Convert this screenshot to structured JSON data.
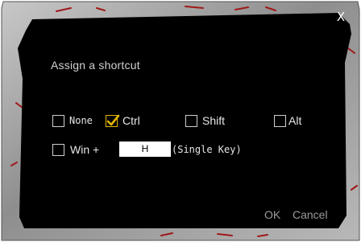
{
  "dialog": {
    "title": "Assign a shortcut",
    "close_label": "X"
  },
  "modifiers": [
    {
      "label": "None",
      "checked": false
    },
    {
      "label": "Ctrl",
      "checked": true
    },
    {
      "label": "Shift",
      "checked": false
    },
    {
      "label": "Alt",
      "checked": false
    }
  ],
  "win": {
    "label": "Win +",
    "checked": false,
    "key_value": "H",
    "hint": "(Single Key)"
  },
  "buttons": {
    "ok": "OK",
    "cancel": "Cancel"
  },
  "colors": {
    "panel": "#000000",
    "frame": "#9a9a9a",
    "accent_check": "#e3b300",
    "text": "#e6e6e6",
    "button_text": "#9a9a9a"
  }
}
